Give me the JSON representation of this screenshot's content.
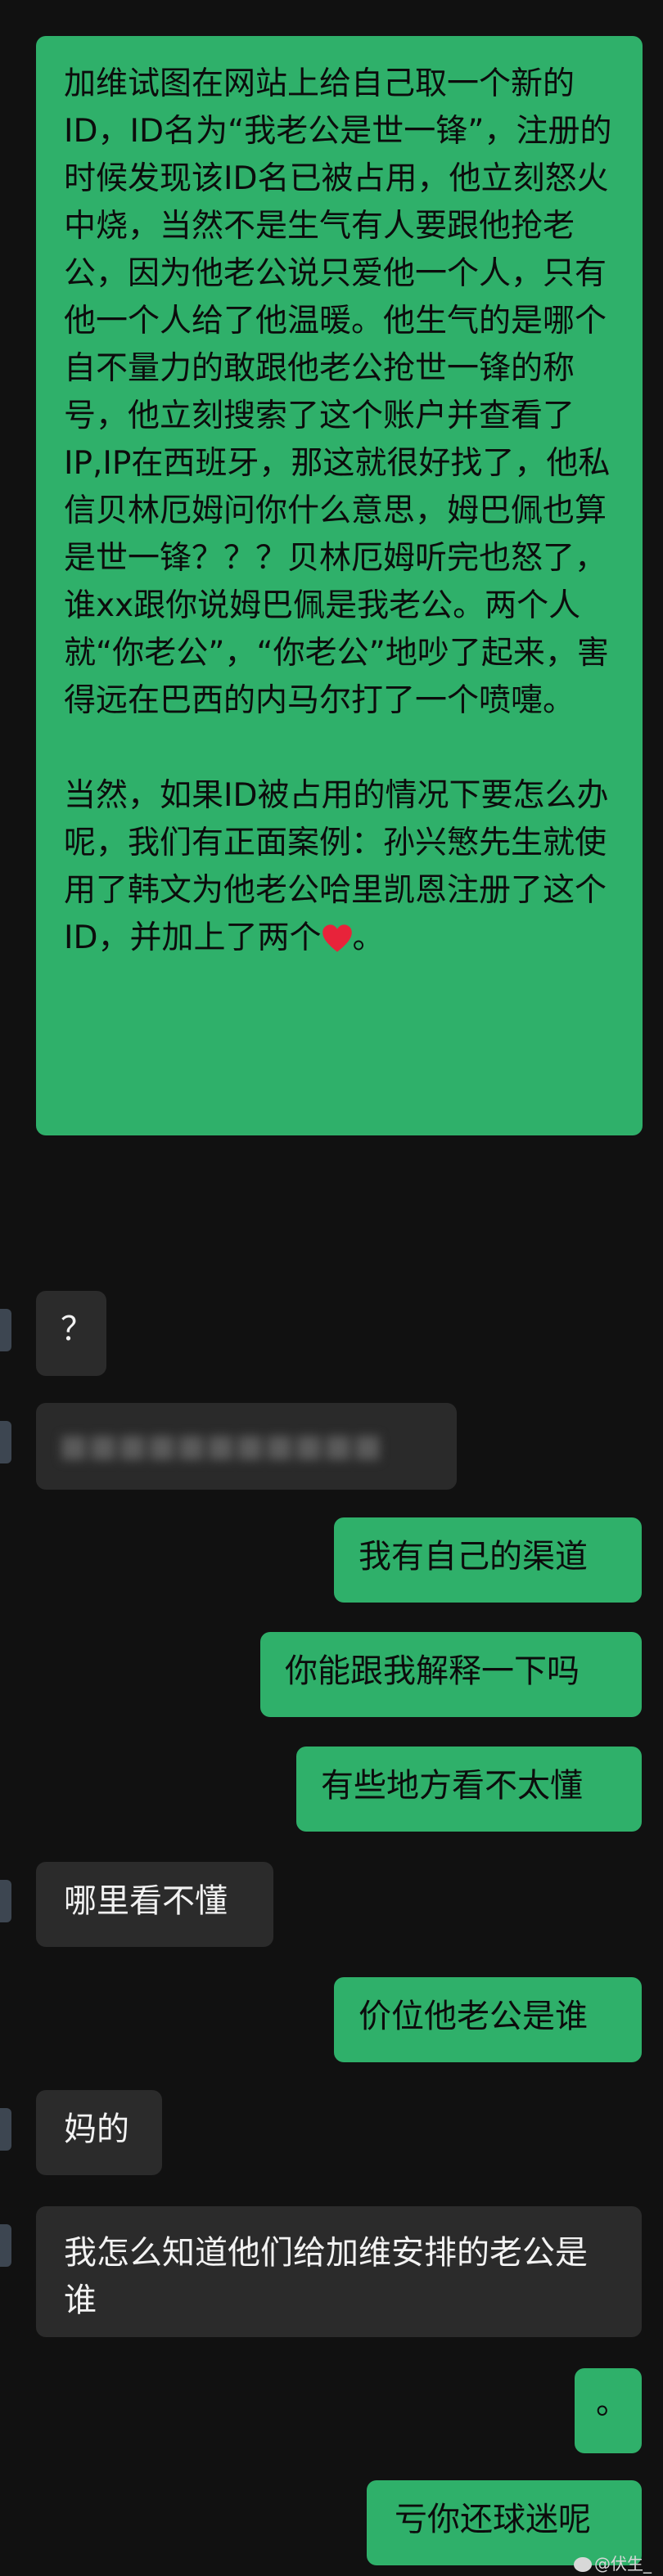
{
  "messages": [
    {
      "side": "right",
      "paragraph1": "加维试图在网站上给自己取一个新的ID，ID名为“我老公是世一锋”，注册的时候发现该ID名已被占用，他立刻怒火中烧，当然不是生气有人要跟他抢老公，因为他老公说只爱他一个人，只有他一个人给了他温暖。他生气的是哪个自不量力的敢跟他老公抢世一锋的称号，他立刻搜索了这个账户并查看了IP,IP在西班牙，那这就很好找了，他私信贝林厄姆问你什么意思，姆巴佩也算是世一锋？？？贝林厄姆听完也怒了，谁xx跟你说姆巴佩是我老公。两个人就“你老公”，“你老公”地吵了起来，害得远在巴西的内马尔打了一个喷嚏。",
      "paragraph2": "当然，如果ID被占用的情况下要怎么办呢，我们有正面案例：孙兴慜先生就使用了韩文为他老公哈里凯恩注册了这个ID，并加上了两个",
      "paragraph2_end": "。",
      "heart_icon": "red-heart-icon"
    },
    {
      "side": "left",
      "text": "？"
    },
    {
      "side": "left",
      "text": "",
      "blurred": true
    },
    {
      "side": "right",
      "text": "我有自己的渠道"
    },
    {
      "side": "right",
      "text": "你能跟我解释一下吗"
    },
    {
      "side": "right",
      "text": "有些地方看不太懂"
    },
    {
      "side": "left",
      "text": "哪里看不懂"
    },
    {
      "side": "right",
      "text": "价位他老公是谁"
    },
    {
      "side": "left",
      "text": "妈的"
    },
    {
      "side": "left",
      "text": "我怎么知道他们给加维安排的老公是谁"
    },
    {
      "side": "right",
      "text": "。"
    },
    {
      "side": "right",
      "text": "亏你还球迷呢"
    }
  ],
  "watermark": "@伏生_",
  "colors": {
    "background": "#111111",
    "outgoing": "#2fb06a",
    "incoming": "#2b2b2b"
  }
}
